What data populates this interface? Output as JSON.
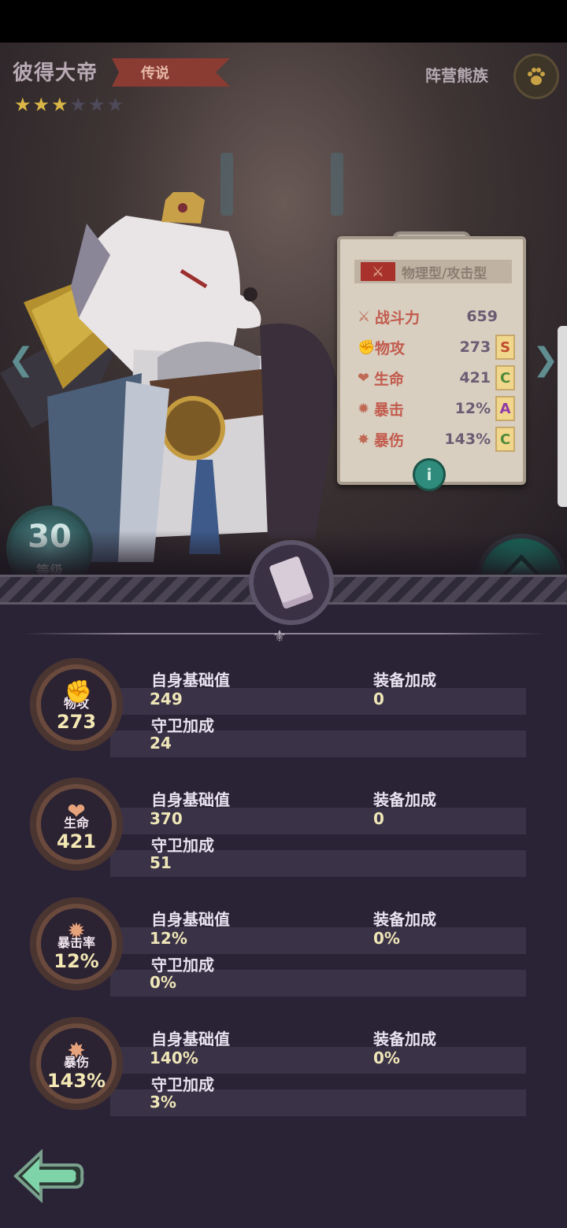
{
  "hero": {
    "name": "彼得大帝",
    "rarity": "传说",
    "stars_filled": 3,
    "stars_total": 6,
    "faction_label": "阵营熊族",
    "faction_icon": "paw-icon",
    "level": "30",
    "level_label": "等级"
  },
  "summary_card": {
    "type_label": "物理型/攻击型",
    "rows": [
      {
        "icon": "power-icon",
        "label": "战斗力",
        "value": "659",
        "grade": ""
      },
      {
        "icon": "fist-icon",
        "label": "物攻",
        "value": "273",
        "grade": "S"
      },
      {
        "icon": "heart-icon",
        "label": "生命",
        "value": "421",
        "grade": "C"
      },
      {
        "icon": "crit-icon",
        "label": "暴击",
        "value": "12%",
        "grade": "A"
      },
      {
        "icon": "burst-icon",
        "label": "暴伤",
        "value": "143%",
        "grade": "C"
      }
    ],
    "info_label": "i"
  },
  "stats": [
    {
      "name": "物攻",
      "total": "273",
      "icon": "fist-icon",
      "base_label": "自身基础值",
      "base": "249",
      "equip_label": "装备加成",
      "equip": "0",
      "guard_label": "守卫加成",
      "guard": "24"
    },
    {
      "name": "生命",
      "total": "421",
      "icon": "heart-icon",
      "base_label": "自身基础值",
      "base": "370",
      "equip_label": "装备加成",
      "equip": "0",
      "guard_label": "守卫加成",
      "guard": "51"
    },
    {
      "name": "暴击率",
      "total": "12%",
      "icon": "crit-icon",
      "base_label": "自身基础值",
      "base": "12%",
      "equip_label": "装备加成",
      "equip": "0%",
      "guard_label": "守卫加成",
      "guard": "0%"
    },
    {
      "name": "暴伤",
      "total": "143%",
      "icon": "burst-icon",
      "base_label": "自身基础值",
      "base": "140%",
      "equip_label": "装备加成",
      "equip": "0%",
      "guard_label": "守卫加成",
      "guard": "3%"
    }
  ],
  "colors": {
    "accent_teal": "#2aa38c",
    "ribbon_red": "#8a3b32",
    "star_gold": "#d9b647",
    "value_yellow": "#efe6b8"
  }
}
